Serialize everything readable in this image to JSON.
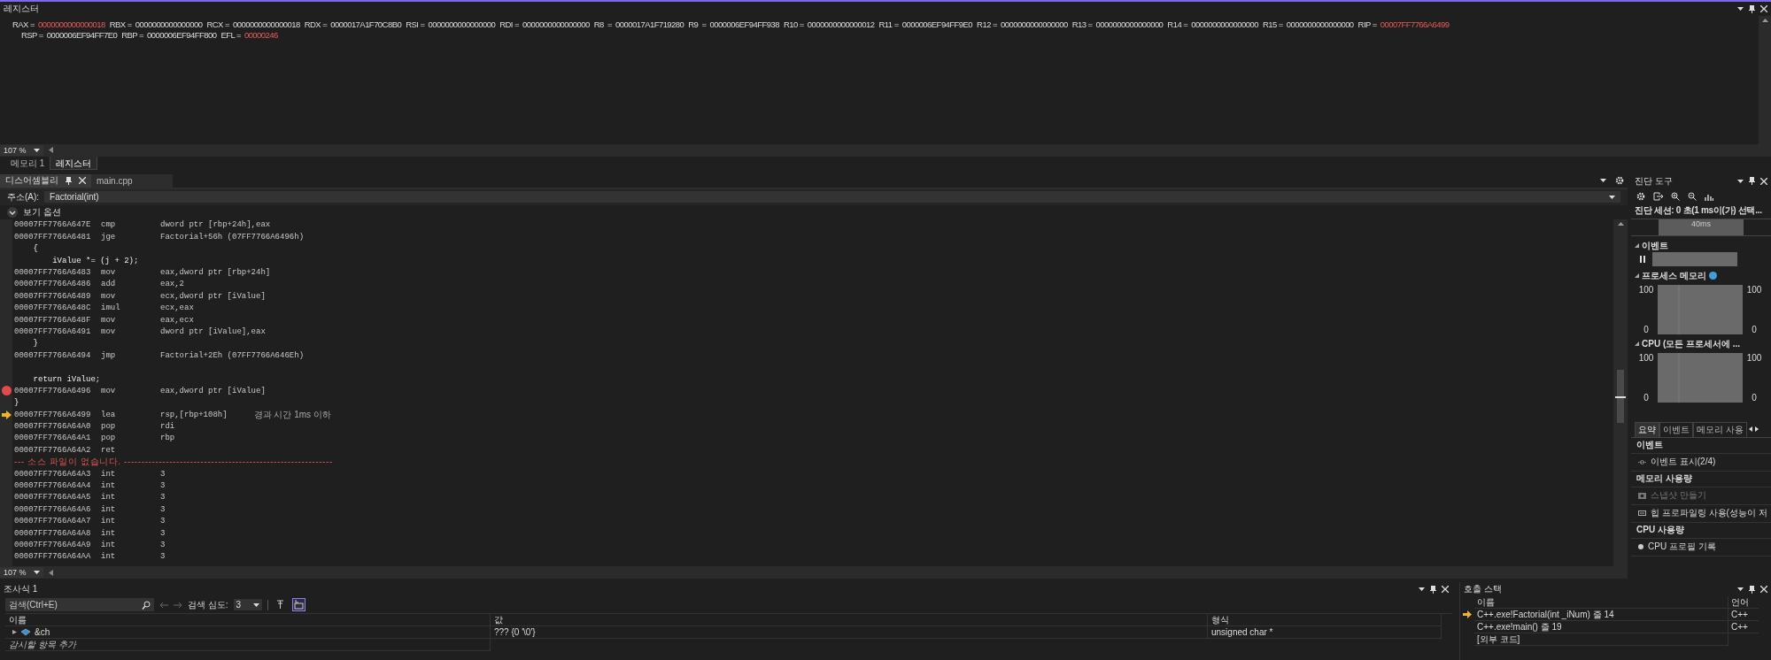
{
  "registers": {
    "title": "레지스터",
    "zoom": "107 %",
    "lines": [
      [
        {
          "name": "RAX =",
          "value": "0000000000000018",
          "changed": true
        },
        {
          "name": "RBX =",
          "value": "0000000000000000",
          "changed": false
        },
        {
          "name": "RCX =",
          "value": "0000000000000018",
          "changed": false
        },
        {
          "name": "RDX =",
          "value": "0000017A1F70C8B0",
          "changed": false
        },
        {
          "name": "RSI =",
          "value": "0000000000000000",
          "changed": false
        },
        {
          "name": "RDI =",
          "value": "0000000000000000",
          "changed": false
        },
        {
          "name": "R8  =",
          "value": "0000017A1F719280",
          "changed": false
        },
        {
          "name": "R9  =",
          "value": "0000006EF94FF938",
          "changed": false
        },
        {
          "name": "R10 =",
          "value": "0000000000000012",
          "changed": false
        },
        {
          "name": "R11 =",
          "value": "0000006EF94FF9E0",
          "changed": false
        },
        {
          "name": "R12 =",
          "value": "0000000000000000",
          "changed": false
        },
        {
          "name": "R13 =",
          "value": "0000000000000000",
          "changed": false
        },
        {
          "name": "R14 =",
          "value": "0000000000000000",
          "changed": false
        },
        {
          "name": "R15 =",
          "value": "0000000000000000",
          "changed": false
        },
        {
          "name": "RIP =",
          "value": "00007FF7766A6499",
          "changed": true
        }
      ],
      [
        {
          "name": "RSP =",
          "value": "0000006EF94FF7E0",
          "changed": false
        },
        {
          "name": "RBP =",
          "value": "0000006EF94FF800",
          "changed": false
        },
        {
          "name": "EFL =",
          "value": "00000246",
          "changed": true
        }
      ]
    ]
  },
  "bottom_tabs": [
    {
      "label": "메모리 1",
      "selected": false
    },
    {
      "label": "레지스터",
      "selected": true
    }
  ],
  "disassembly": {
    "tabs": [
      {
        "label": "디스어셈블리",
        "selected": true
      },
      {
        "label": "main.cpp",
        "selected": false
      }
    ],
    "address_label": "주소(A):",
    "address": "Factorial(int)",
    "view_options": {
      "label": "보기 옵션",
      "expanded": true
    },
    "zoom": "107 %",
    "lines": [
      {
        "kind": "asm",
        "address": "00007FF7766A647E",
        "op": "cmp",
        "operands": "dword ptr [rbp+24h],eax",
        "breakpoint": false,
        "current": false
      },
      {
        "kind": "asm",
        "address": "00007FF7766A6481",
        "op": "jge",
        "operands": "Factorial+56h (07FF7766A6496h)",
        "breakpoint": false,
        "current": false
      },
      {
        "kind": "source",
        "text": "    {"
      },
      {
        "kind": "source",
        "text": "        iValue *= (j + 2);"
      },
      {
        "kind": "asm",
        "address": "00007FF7766A6483",
        "op": "mov",
        "operands": "eax,dword ptr [rbp+24h]",
        "breakpoint": false,
        "current": false
      },
      {
        "kind": "asm",
        "address": "00007FF7766A6486",
        "op": "add",
        "operands": "eax,2",
        "breakpoint": false,
        "current": false
      },
      {
        "kind": "asm",
        "address": "00007FF7766A6489",
        "op": "mov",
        "operands": "ecx,dword ptr [iValue]",
        "breakpoint": false,
        "current": false
      },
      {
        "kind": "asm",
        "address": "00007FF7766A648C",
        "op": "imul",
        "operands": "ecx,eax",
        "breakpoint": false,
        "current": false
      },
      {
        "kind": "asm",
        "address": "00007FF7766A648F",
        "op": "mov",
        "operands": "eax,ecx",
        "breakpoint": false,
        "current": false
      },
      {
        "kind": "asm",
        "address": "00007FF7766A6491",
        "op": "mov",
        "operands": "dword ptr [iValue],eax",
        "breakpoint": false,
        "current": false
      },
      {
        "kind": "source",
        "text": "    }"
      },
      {
        "kind": "asm",
        "address": "00007FF7766A6494",
        "op": "jmp",
        "operands": "Factorial+2Eh (07FF7766A646Eh)",
        "breakpoint": false,
        "current": false
      },
      {
        "kind": "blank"
      },
      {
        "kind": "source",
        "text": "    return iValue;"
      },
      {
        "kind": "asm",
        "address": "00007FF7766A6496",
        "op": "mov",
        "operands": "eax,dword ptr [iValue]",
        "breakpoint": true,
        "current": false
      },
      {
        "kind": "source",
        "text": "}"
      },
      {
        "kind": "asm",
        "address": "00007FF7766A6499",
        "op": "lea",
        "operands": "rsp,[rbp+108h]",
        "note": "경과 시간 1ms 이하",
        "breakpoint": false,
        "current": true
      },
      {
        "kind": "asm",
        "address": "00007FF7766A64A0",
        "op": "pop",
        "operands": "rdi",
        "breakpoint": false,
        "current": false
      },
      {
        "kind": "asm",
        "address": "00007FF7766A64A1",
        "op": "pop",
        "operands": "rbp",
        "breakpoint": false,
        "current": false
      },
      {
        "kind": "asm",
        "address": "00007FF7766A64A2",
        "op": "ret",
        "breakpoint": false,
        "current": false
      },
      {
        "kind": "banner",
        "text": "--- 소스 파일이 없습니다. ------------------------------------------------------------"
      },
      {
        "kind": "asm",
        "address": "00007FF7766A64A3",
        "op": "int",
        "operands": "3",
        "breakpoint": false,
        "current": false
      },
      {
        "kind": "asm",
        "address": "00007FF7766A64A4",
        "op": "int",
        "operands": "3",
        "breakpoint": false,
        "current": false
      },
      {
        "kind": "asm",
        "address": "00007FF7766A64A5",
        "op": "int",
        "operands": "3",
        "breakpoint": false,
        "current": false
      },
      {
        "kind": "asm",
        "address": "00007FF7766A64A6",
        "op": "int",
        "operands": "3",
        "breakpoint": false,
        "current": false
      },
      {
        "kind": "asm",
        "address": "00007FF7766A64A7",
        "op": "int",
        "operands": "3",
        "breakpoint": false,
        "current": false
      },
      {
        "kind": "asm",
        "address": "00007FF7766A64A8",
        "op": "int",
        "operands": "3",
        "breakpoint": false,
        "current": false
      },
      {
        "kind": "asm",
        "address": "00007FF7766A64A9",
        "op": "int",
        "operands": "3",
        "breakpoint": false,
        "current": false
      },
      {
        "kind": "asm",
        "address": "00007FF7766A64AA",
        "op": "int",
        "operands": "3",
        "breakpoint": false,
        "current": false
      }
    ]
  },
  "diagnostics": {
    "title": "진단 도구",
    "session": "진단 세션: 0 초(1 ms이(가) 선택...",
    "ruler": "40ms",
    "tracks": [
      {
        "kind": "events",
        "title": "이벤트",
        "expanded": true
      },
      {
        "kind": "graph",
        "title": "프로세스 메모리",
        "expanded": true,
        "left_max": "100",
        "left_min": "0",
        "right_max": "100",
        "right_min": "0"
      },
      {
        "kind": "graph",
        "title": "CPU (모든 프로세서에 ...",
        "expanded": true,
        "left_max": "100",
        "left_min": "0",
        "right_max": "100",
        "right_min": "0"
      }
    ],
    "tabs": [
      {
        "label": "요약",
        "selected": true
      },
      {
        "label": "이벤트",
        "selected": false
      },
      {
        "label": "메모리 사용",
        "selected": false
      }
    ],
    "summary": [
      {
        "title": "이벤트",
        "items": [
          {
            "label": "이벤트 표시(2/4)",
            "disabled": false
          }
        ]
      },
      {
        "title": "메모리 사용량",
        "items": [
          {
            "label": "스냅샷 만들기",
            "disabled": true
          },
          {
            "label": "힙 프로파일링 사용(성능이 저",
            "disabled": false
          }
        ]
      },
      {
        "title": "CPU 사용량",
        "items": [
          {
            "label": "CPU 프로필 기록",
            "disabled": false
          }
        ]
      }
    ]
  },
  "watch": {
    "title": "조사식 1",
    "search": {
      "placeholder": "검색(Ctrl+E)"
    },
    "depth_label": "검색 심도:",
    "depth": "3",
    "toggles": [
      {
        "selected": false
      },
      {
        "selected": true
      }
    ],
    "columns": [
      "이름",
      "값",
      "형식"
    ],
    "rows": [
      {
        "name": "&ch",
        "value": "??? {0 '\\0'}",
        "type": "unsigned char *",
        "expanded": false
      }
    ],
    "add_row": "감시할 항목 추가"
  },
  "call_stack": {
    "title": "호출 스택",
    "columns": [
      "이름",
      "언어"
    ],
    "rows": [
      {
        "name": "C++.exe!Factorial(int _iNum) 줄 14",
        "language": "C++",
        "current": true
      },
      {
        "name": "C++.exe!main() 줄 19",
        "language": "C++",
        "current": false
      },
      {
        "name": "[외부 코드]",
        "current": false
      }
    ]
  }
}
